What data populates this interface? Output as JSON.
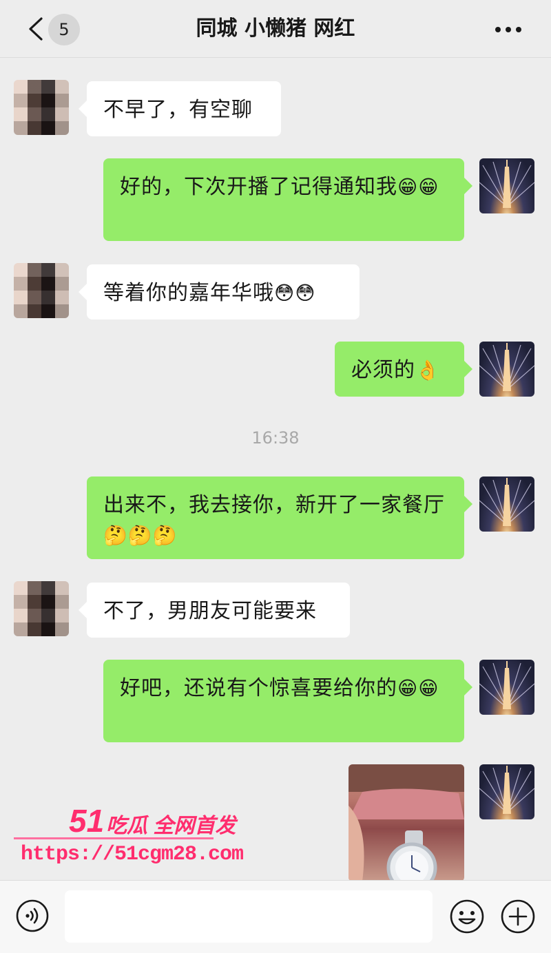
{
  "header": {
    "unread_count": "5",
    "title": "同城 小懒猪 网红",
    "back_icon": "chevron-left-icon",
    "more_icon": "ellipsis-icon"
  },
  "messages": [
    {
      "side": "in",
      "text": "不早了，有空聊"
    },
    {
      "side": "out",
      "text": "好的，下次开播了记得通知我",
      "emoji": "😁😁"
    },
    {
      "side": "in",
      "text": "等着你的嘉年华哦",
      "emoji": "😳😳"
    },
    {
      "side": "out",
      "text": "必须的",
      "emoji": "👌"
    },
    {
      "side": "out",
      "text": "出来不，我去接你，新开了一家餐厅",
      "emoji": "🤔🤔🤔"
    },
    {
      "side": "in",
      "text": "不了，男朋友可能要来"
    },
    {
      "side": "out",
      "text": "好吧，还说有个惊喜要给你的",
      "emoji": "😁😁"
    },
    {
      "side": "out",
      "type": "image",
      "description": "watch-photo"
    }
  ],
  "timestamp": "16:38",
  "watermark": {
    "title": "吃瓜 全网首发",
    "number": "51",
    "url": "https://51cgm28.com"
  },
  "input_bar": {
    "voice_icon": "voice-icon",
    "emoji_icon": "smiley-icon",
    "plus_icon": "plus-circle-icon",
    "placeholder": ""
  },
  "colors": {
    "outgoing_bubble": "#95ec69",
    "incoming_bubble": "#ffffff",
    "background": "#ededed",
    "watermark": "#ff2d6e"
  }
}
